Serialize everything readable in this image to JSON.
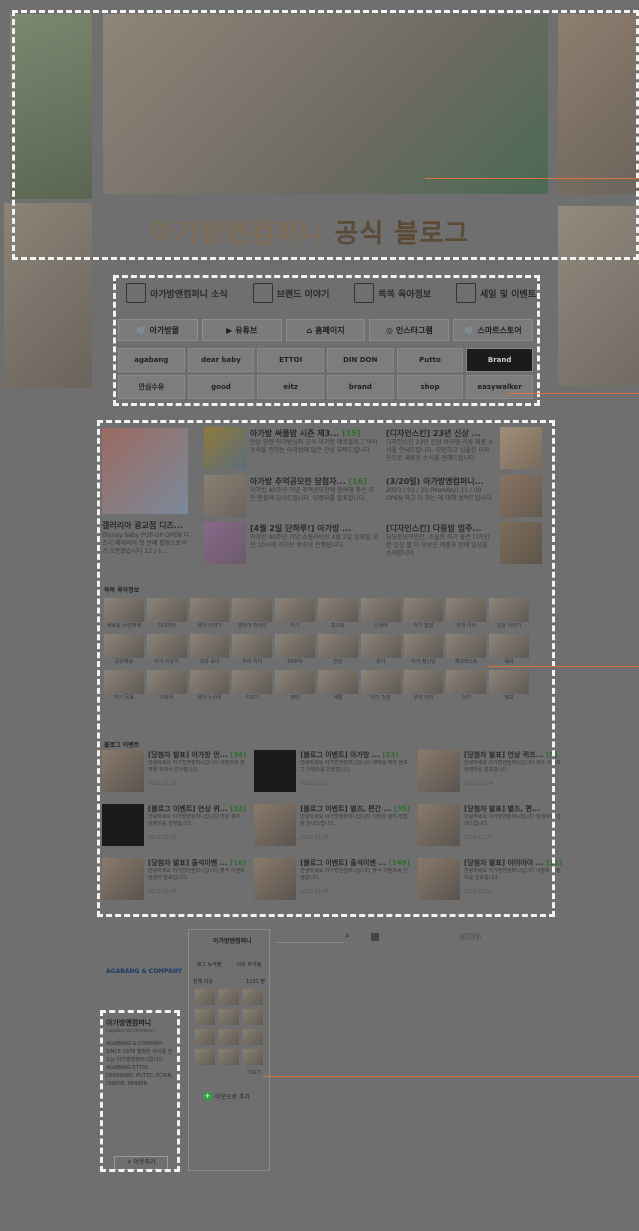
{
  "header": {
    "title_a": "아가방앤컴퍼니",
    "title_b": "공식 블로그"
  },
  "menu": [
    {
      "label": "아가방앤컴퍼니 소식"
    },
    {
      "label": "브랜드 이야기"
    },
    {
      "label": "쏙쏙 육아정보"
    },
    {
      "label": "세일 및 이벤트"
    }
  ],
  "buttons": [
    {
      "label": "아가방몰",
      "icon": "cart-icon"
    },
    {
      "label": "유튜브",
      "icon": "play-icon"
    },
    {
      "label": "홈페이지",
      "icon": "home-icon"
    },
    {
      "label": "인스타그램",
      "icon": "instagram-icon"
    },
    {
      "label": "스마트스토어",
      "icon": "cart-icon"
    }
  ],
  "brands": [
    "agabang",
    "dear baby",
    "ETTOI",
    "DIN DON",
    "Putto",
    "Brand",
    "안심수유",
    "good",
    "eitz",
    "brand",
    "shop",
    "easywalker"
  ],
  "featured": {
    "caption": "갤러리아 광교점 디즈...",
    "text": "Disney baby POP-UP OPEN 디즈니 베이비의 첫 번째 팝업스토어가 오픈했습니다 12 / 1..."
  },
  "posts": [
    {
      "title": "아가방 써클맘 시즌 제3...",
      "badge": "[15]",
      "text": "안녕 맘앤 아가방님의 공식 아가방 에코블로그 아이 소식을 전하는 아가방에 많은 관심 부탁드립니다."
    },
    {
      "title": "[디자인스킨] 23년 신상 ...",
      "badge": "",
      "text": "디자인스킨 23년 신상 아이템 리빙 제품 소식을 안내드립니다. 모던하고 심플한 디자인으로 새로운 소식을 전해드립니다."
    },
    {
      "title": "아가방 추억공모전 당첨자...",
      "badge": "[16]",
      "text": "아가방 40주년 기념 추억공모전에 참여해 주신 모든 분들께 감사드립니다. 당첨자를 발표합니다."
    },
    {
      "title": "(3/20일) 아가방앤컴퍼니...",
      "badge": "",
      "text": "2023 / 03 / 20 (Monday) 11 / 00 OPEN 하고 어 하는 에 대해 보여드립니다."
    },
    {
      "title": "[4월 2일 단하루!] 아가방 ...",
      "badge": "",
      "text": "아가방 40주년 기념 쇼핑라이브 4월 2일 일요일 오전 10시에 라이브 방송이 진행됩니다."
    },
    {
      "title": "[디자인스킨] 다둥맘 엄주...",
      "badge": "",
      "text": "딩딩동보이민간, 소울한 하기 좋은 디자인한 일상 활 다 이로운 제품과 함께 일상을 소개합니다."
    }
  ],
  "sections": {
    "info": "쏙쏙 육아정보",
    "event": "블로그 이벤트"
  },
  "thumbs": [
    "새로운 수면체계",
    "기다리던",
    "육아 이야기",
    "영유아 마사지",
    "아기",
    "포스트",
    "신생아",
    "아기 발달",
    "우리 아이",
    "건강 이야기",
    "공유해요",
    "아기 이유식",
    "쏙쏙 육아",
    "우리 아이",
    "20주차",
    "건강",
    "유아",
    "아기 장난감",
    "체크리스트",
    "육아",
    "아기 목욕",
    "이유식",
    "육아 노하우",
    "이야기",
    "뷰티",
    "계절",
    "아기 건강",
    "우리 아이",
    "아기",
    "정보"
  ],
  "events": [
    {
      "title": "[당첨자 발표] 아가방 안...",
      "badge": "[34]",
      "text": "안녕하세요 아가방앤컴퍼니입니다 이벤트에 참여해 주셔서 감사합니다.",
      "date": "2019.12.30.",
      "dark": false
    },
    {
      "title": "[블로그 이벤트] 아가방 ...",
      "badge": "[33]",
      "text": "안녕하세요 아가방앤컴퍼니입니다 새해를 맞아 블로그 이벤트를 진행합니다.",
      "date": "2019.12.11.",
      "dark": true
    },
    {
      "title": "[당첨자 발표] 연상 퀴즈...",
      "badge": "[5]",
      "text": "안녕하세요 아가방앤컴퍼니입니다 퀴즈 이벤트 당첨자를 발표합니다.",
      "date": "2019.10.14.",
      "dark": false
    },
    {
      "title": "[블로그 이벤트] 연상 퀴...",
      "badge": "[33]",
      "text": "안녕하세요 아가방앤컴퍼니입니다 연상 퀴즈 이벤트를 진행합니다.",
      "date": "2019.12.01.",
      "dark": true
    },
    {
      "title": "[블로그 이벤트] 별즈, 편간 ...",
      "badge": "[35]",
      "text": "안녕하세요 아가방앤컴퍼니입니다 이벤트 참여 방법을 안내드립니다.",
      "date": "2019.11.18.",
      "dark": false
    },
    {
      "title": "[당첨자 발표] 별즈, 편...",
      "badge": "",
      "text": "안녕하세요 아가방앤컴퍼니입니다 당첨자를 안내드립니다.",
      "date": "2019.11.27.",
      "dark": false
    },
    {
      "title": "[당첨자 발표] 출석이벤 ...",
      "badge": "[16]",
      "text": "안녕하세요 아가방앤컴퍼니입니다 출석 이벤트 당첨자 발표입니다.",
      "date": "2019.10.28.",
      "dark": false
    },
    {
      "title": "[블로그 이벤트] 출석이벤 ...",
      "badge": "[149]",
      "text": "안녕하세요 아가방앤컴퍼니입니다 출석 이벤트를 진행합니다.",
      "date": "2019.11.08.",
      "dark": false
    },
    {
      "title": "[당첨자 발표] 이어아이 ...",
      "badge": "[11]",
      "text": "안녕하세요 아가방앤컴퍼니입니다 이벤트 당첨자를 발표합니다.",
      "date": "2019.10.31.",
      "dark": false
    }
  ],
  "sidebar": {
    "brand": "AGABANG & COMPANY",
    "name": "아가방앤컴퍼니",
    "id": "(agabangcompany)",
    "desc": "AGABANG & COMPANY SINCE 1979 행복한 아이를 만드는 아가방앤컴퍼니입니다 AGABANG ETTOI, DEARBABY, PUTTO, ECRIN, DIBERE, MINIKIN",
    "add": "+ 이웃추가",
    "widget_title": "아가방앤컴퍼니",
    "tab_a": "태그 뉴거볼",
    "tab_b": "이웃 추가됨",
    "count_label": "전체 이웃",
    "count": "1101 명",
    "neighbor_btn": "이웃으로 추가",
    "more": "더보기"
  }
}
